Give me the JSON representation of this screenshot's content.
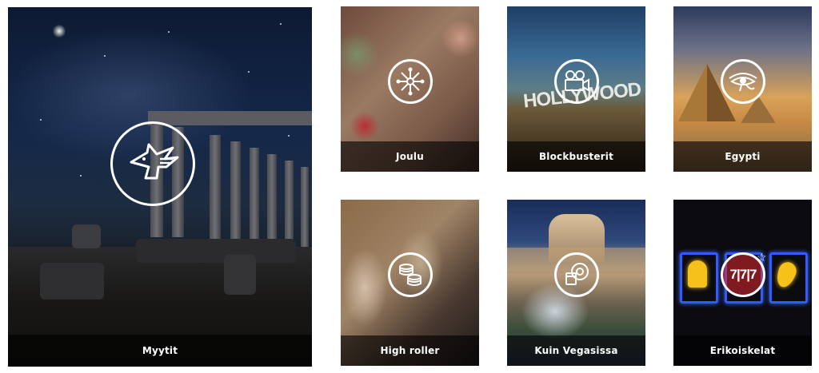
{
  "tiles": [
    {
      "id": "myytit",
      "label": "Myytit",
      "icon": "pegasus-icon"
    },
    {
      "id": "joulu",
      "label": "Joulu",
      "icon": "snowflake-icon"
    },
    {
      "id": "blockbusterit",
      "label": "Blockbusterit",
      "icon": "movie-camera-icon"
    },
    {
      "id": "egypti",
      "label": "Egypti",
      "icon": "eye-of-horus-icon"
    },
    {
      "id": "high-roller",
      "label": "High roller",
      "icon": "coin-stack-icon"
    },
    {
      "id": "kuin-vegasissa",
      "label": "Kuin Vegasissa",
      "icon": "roulette-icon"
    },
    {
      "id": "erikoiskelat",
      "label": "Erikoiskelat",
      "icon": "slot-777-icon"
    }
  ],
  "scenery": {
    "hollywood_sign": "HOLLYWOOD",
    "slot_symbols": "7|7|7"
  },
  "colors": {
    "label_text": "#ffffff",
    "label_bar": "rgba(0,0,0,0.62)",
    "icon_stroke": "#ffffff",
    "neon_blue": "#2f5bff",
    "neon_yellow": "#f6c21a",
    "neon_red": "#e0282e"
  }
}
